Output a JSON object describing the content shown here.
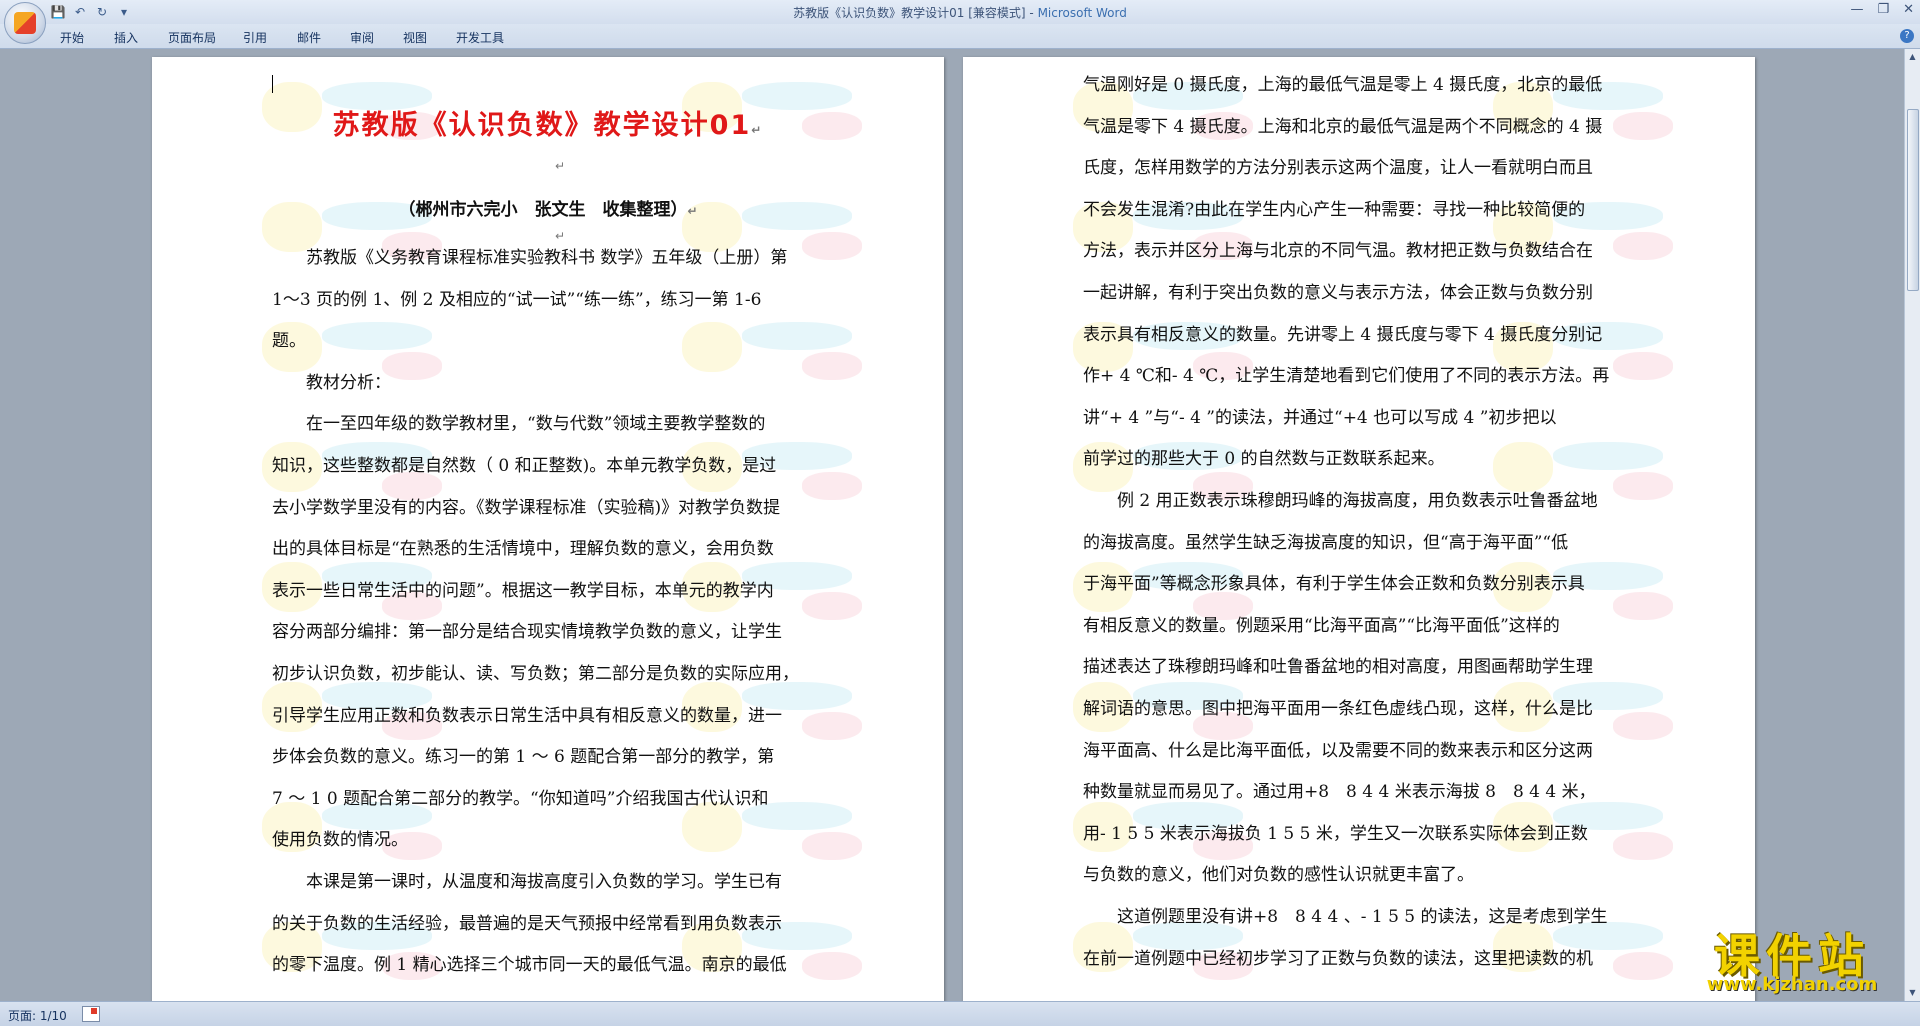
{
  "window": {
    "title_main": "苏教版《认识负数》教学设计01 [兼容模式] - ",
    "title_app": "Microsoft Word"
  },
  "ribbon": {
    "tabs": [
      "开始",
      "插入",
      "页面布局",
      "引用",
      "邮件",
      "审阅",
      "视图",
      "开发工具"
    ]
  },
  "page1": {
    "title": "苏教版《认识负数》教学设计01",
    "subtitle": "（郴州市六完小　张文生　收集整理）",
    "lines": [
      "　　苏教版《义务教育课程标准实验教科书 数学》五年级（上册）第",
      "1～3 页的例 1、例 2 及相应的“试一试”“练一练”，练习一第 1-6",
      "题。",
      "　　教材分析：",
      "　　在一至四年级的数学教材里，“数与代数”领域主要教学整数的",
      "知识，这些整数都是自然数（ 0 和正整数)。本单元教学负数，是过",
      "去小学数学里没有的内容。《数学课程标准（实验稿)》对教学负数提",
      "出的具体目标是“在熟悉的生活情境中，理解负数的意义，会用负数",
      "表示一些日常生活中的问题”。根据这一教学目标，本单元的教学内",
      "容分两部分编排：第一部分是结合现实情境教学负数的意义，让学生",
      "初步认识负数，初步能认、读、写负数；第二部分是负数的实际应用，",
      "引导学生应用正数和负数表示日常生活中具有相反意义的数量，进一",
      "步体会负数的意义。练习一的第 1 ～ 6 题配合第一部分的教学，第",
      "7 ～ 1 0 题配合第二部分的教学。“你知道吗”介绍我国古代认识和",
      "使用负数的情况。",
      "　　本课是第一课时，从温度和海拔高度引入负数的学习。学生已有",
      "的关于负数的生活经验，最普遍的是天气预报中经常看到用负数表示",
      "的零下温度。例 1 精心选择三个城市同一天的最低气温。南京的最低"
    ]
  },
  "page2": {
    "lines": [
      "气温刚好是 0 摄氏度，上海的最低气温是零上 4 摄氏度，北京的最低",
      "气温是零下 4 摄氏度。上海和北京的最低气温是两个不同概念的 4 摄",
      "氏度，怎样用数学的方法分别表示这两个温度，让人一看就明白而且",
      "不会发生混淆?由此在学生内心产生一种需要：寻找一种比较简便的",
      "方法，表示并区分上海与北京的不同气温。教材把正数与负数结合在",
      "一起讲解，有利于突出负数的意义与表示方法，体会正数与负数分别",
      "表示具有相反意义的数量。先讲零上 4 摄氏度与零下 4 摄氏度分别记",
      "作+ 4 ℃和- 4 ℃，让学生清楚地看到它们使用了不同的表示方法。再",
      "讲“+ 4 ”与“- 4 ”的读法，并通过“+4 也可以写成 4 ”初步把以",
      "前学过的那些大于 0 的自然数与正数联系起来。",
      "　　例 2 用正数表示珠穆朗玛峰的海拔高度，用负数表示吐鲁番盆地",
      "的海拔高度。虽然学生缺乏海拔高度的知识，但“高于海平面”“低",
      "于海平面”等概念形象具体，有利于学生体会正数和负数分别表示具",
      "有相反意义的数量。例题采用“比海平面高”“比海平面低”这样的",
      "描述表达了珠穆朗玛峰和吐鲁番盆地的相对高度，用图画帮助学生理",
      "解词语的意思。图中把海平面用一条红色虚线凸现，这样，什么是比",
      "海平面高、什么是比海平面低，以及需要不同的数来表示和区分这两",
      "种数量就显而易见了。通过用+8　8 4 4 米表示海拔 8　8 4 4 米，",
      "用- 1 5 5 米表示海拔负 1 5 5 米，学生又一次联系实际体会到正数",
      "与负数的意义，他们对负数的感性认识就更丰富了。",
      "　　这道例题里没有讲+8　8 4 4 、- 1 5 5 的读法，这是考虑到学生",
      "在前一道例题中已经初步学习了正数与负数的读法，这里把读数的机"
    ]
  },
  "statusbar": {
    "page_label": "页面: 1/10"
  },
  "site_logo": {
    "text_cn": "课件站",
    "url": "www.kjzhan.com"
  },
  "colors": {
    "title_red": "#e01818",
    "logo_yellow": "#f2d200",
    "workspace": "#9da8b6"
  }
}
